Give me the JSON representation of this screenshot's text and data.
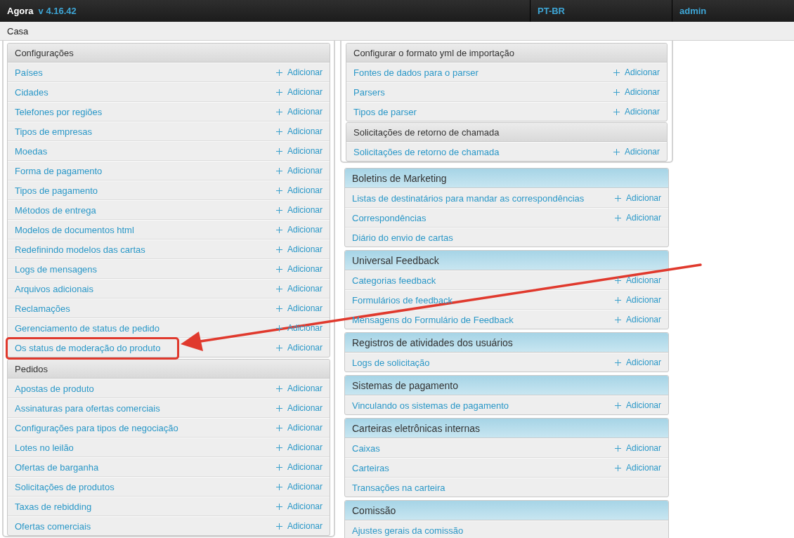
{
  "topbar": {
    "brand": "Agora",
    "version": "v 4.16.42",
    "language": "PT-BR",
    "user": "admin"
  },
  "breadcrumb": "Casa",
  "columns": [
    {
      "frame": {
        "modules": [
          {
            "title": "Configurações",
            "kind": "plain",
            "items": [
              {
                "label": "Países",
                "add": "Adicionar",
                "highlighted": false
              },
              {
                "label": "Cidades",
                "add": "Adicionar",
                "highlighted": false
              },
              {
                "label": "Telefones por regiões",
                "add": "Adicionar",
                "highlighted": false
              },
              {
                "label": "Tipos de empresas",
                "add": "Adicionar",
                "highlighted": false
              },
              {
                "label": "Moedas",
                "add": "Adicionar",
                "highlighted": false
              },
              {
                "label": "Forma de pagamento",
                "add": "Adicionar",
                "highlighted": false
              },
              {
                "label": "Tipos de pagamento",
                "add": "Adicionar",
                "highlighted": false
              },
              {
                "label": "Métodos de entrega",
                "add": "Adicionar",
                "highlighted": false
              },
              {
                "label": "Modelos de documentos html",
                "add": "Adicionar",
                "highlighted": false
              },
              {
                "label": "Redefinindo modelos das cartas",
                "add": "Adicionar",
                "highlighted": false
              },
              {
                "label": "Logs de mensagens",
                "add": "Adicionar",
                "highlighted": false
              },
              {
                "label": "Arquivos adicionais",
                "add": "Adicionar",
                "highlighted": false
              },
              {
                "label": "Reclamações",
                "add": "Adicionar",
                "highlighted": false
              },
              {
                "label": "Gerenciamento de status de pedido",
                "add": "Adicionar",
                "highlighted": false
              },
              {
                "label": "Os status de moderação do produto",
                "add": "Adicionar",
                "highlighted": true
              }
            ]
          },
          {
            "title": "Pedidos",
            "kind": "plain",
            "items": [
              {
                "label": "Apostas de produto",
                "add": "Adicionar",
                "highlighted": false
              },
              {
                "label": "Assinaturas para ofertas comerciais",
                "add": "Adicionar",
                "highlighted": false
              },
              {
                "label": "Configurações para tipos de negociação",
                "add": "Adicionar",
                "highlighted": false
              },
              {
                "label": "Lotes no leilão",
                "add": "Adicionar",
                "highlighted": false
              },
              {
                "label": "Ofertas de barganha",
                "add": "Adicionar",
                "highlighted": false
              },
              {
                "label": "Solicitações de produtos",
                "add": "Adicionar",
                "highlighted": false
              },
              {
                "label": "Taxas de rebidding",
                "add": "Adicionar",
                "highlighted": false
              },
              {
                "label": "Ofertas comerciais",
                "add": "Adicionar",
                "highlighted": false
              }
            ]
          }
        ]
      }
    },
    {
      "frame": {
        "modules": [
          {
            "title": "Configurar o formato yml de importação",
            "kind": "plain",
            "items": [
              {
                "label": "Fontes de dados para o parser",
                "add": "Adicionar",
                "highlighted": false
              },
              {
                "label": "Parsers",
                "add": "Adicionar",
                "highlighted": false
              },
              {
                "label": "Tipos de parser",
                "add": "Adicionar",
                "highlighted": false
              }
            ]
          },
          {
            "title": "Solicitações de retorno de chamada",
            "kind": "plain",
            "items": [
              {
                "label": "Solicitações de retorno de chamada",
                "add": "Adicionar",
                "highlighted": false
              }
            ]
          }
        ]
      },
      "modules": [
        {
          "title": "Boletins de Marketing",
          "kind": "blue",
          "items": [
            {
              "label": "Listas de destinatários para mandar as correspondências",
              "add": "Adicionar",
              "highlighted": false
            },
            {
              "label": "Correspondências",
              "add": "Adicionar",
              "highlighted": false
            },
            {
              "label": "Diário do envio de cartas",
              "highlighted": false
            }
          ]
        },
        {
          "title": "Universal Feedback",
          "kind": "blue",
          "items": [
            {
              "label": "Categorias feedback",
              "add": "Adicionar",
              "highlighted": false
            },
            {
              "label": "Formulários de feedback",
              "add": "Adicionar",
              "highlighted": false
            },
            {
              "label": "Mensagens do Formulário de Feedback",
              "add": "Adicionar",
              "highlighted": false
            }
          ]
        },
        {
          "title": "Registros de atividades dos usuários",
          "kind": "blue",
          "items": [
            {
              "label": "Logs de solicitação",
              "add": "Adicionar",
              "highlighted": false
            }
          ]
        },
        {
          "title": "Sistemas de pagamento",
          "kind": "blue",
          "items": [
            {
              "label": "Vinculando os sistemas de pagamento",
              "add": "Adicionar",
              "highlighted": false
            }
          ]
        },
        {
          "title": "Carteiras eletrônicas internas",
          "kind": "blue",
          "items": [
            {
              "label": "Caixas",
              "add": "Adicionar",
              "highlighted": false
            },
            {
              "label": "Carteiras",
              "add": "Adicionar",
              "highlighted": false
            },
            {
              "label": "Transações na carteira",
              "highlighted": false
            }
          ]
        },
        {
          "title": "Comissão",
          "kind": "blue",
          "items": [
            {
              "label": "Ajustes gerais da comissão",
              "highlighted": false
            }
          ]
        }
      ]
    }
  ]
}
